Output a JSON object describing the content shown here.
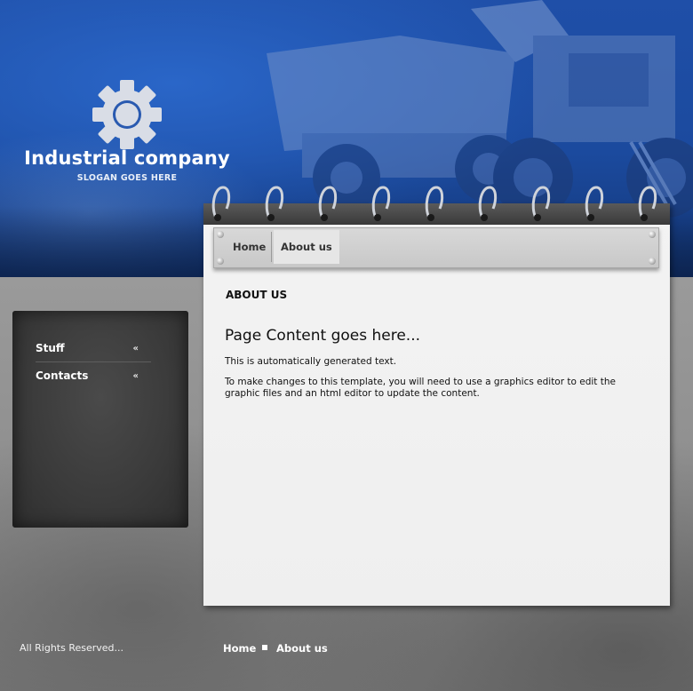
{
  "brand": {
    "company_name": "Industrial company",
    "slogan": "SLOGAN GOES HERE",
    "icon": "gear-icon"
  },
  "nav": {
    "items": [
      {
        "label": "Home",
        "active": false
      },
      {
        "label": "About us",
        "active": true
      }
    ]
  },
  "sidebar": {
    "items": [
      {
        "label": "Stuff",
        "icon": "double-chevron-left-icon"
      },
      {
        "label": "Contacts",
        "icon": "double-chevron-left-icon"
      }
    ]
  },
  "main": {
    "section_title": "ABOUT US",
    "heading": "Page Content goes here...",
    "paragraphs": [
      "This is automatically generated text.",
      "To make changes to this template, you will need to use a graphics editor to edit the graphic files and an html editor to update the content."
    ]
  },
  "footer": {
    "rights": "All Rights Reserved...",
    "links": [
      "Home",
      "About us"
    ]
  },
  "colors": {
    "header_blue": "#1f4fa8",
    "notebook_bg": "#f0f0f0",
    "sidebar_bg": "#3a3a3a"
  }
}
